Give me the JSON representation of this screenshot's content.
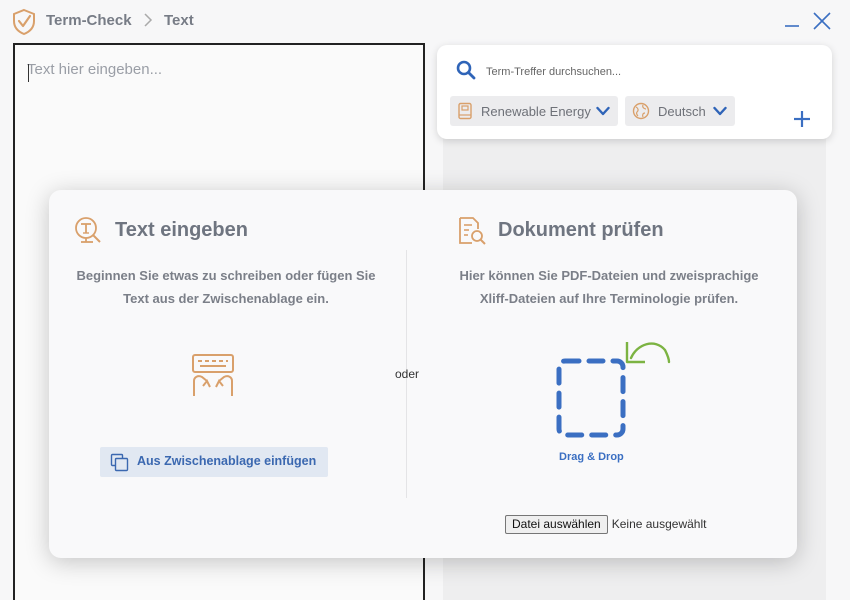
{
  "app": {
    "name": "Term-Check",
    "breadcrumb": "Text",
    "colors": {
      "accent_orange": "#d9a06b",
      "accent_blue": "#3b6fc2",
      "accent_green": "#7cb342"
    }
  },
  "window": {
    "minimize_icon": "minimize-icon",
    "close_icon": "close-icon"
  },
  "editor": {
    "placeholder": "Text hier eingeben...",
    "value": ""
  },
  "search": {
    "placeholder": "Term-Treffer durchsuchen...",
    "domain_value": "Renewable Energy",
    "language_value": "Deutsch",
    "add_icon": "plus-icon"
  },
  "modal": {
    "or_label": "oder",
    "text_section": {
      "title": "Text eingeben",
      "description": "Beginnen Sie etwas zu schreiben oder fügen Sie Text aus der Zwischenablage ein.",
      "paste_button": "Aus Zwischenablage einfügen"
    },
    "document_section": {
      "title": "Dokument prüfen",
      "description": "Hier können Sie PDF-Dateien und zweisprachige Xliff-Dateien auf Ihre Terminologie prüfen.",
      "drop_label": "Drag & Drop",
      "file_button": "Datei auswählen",
      "file_status": "Keine ausgewählt"
    }
  }
}
